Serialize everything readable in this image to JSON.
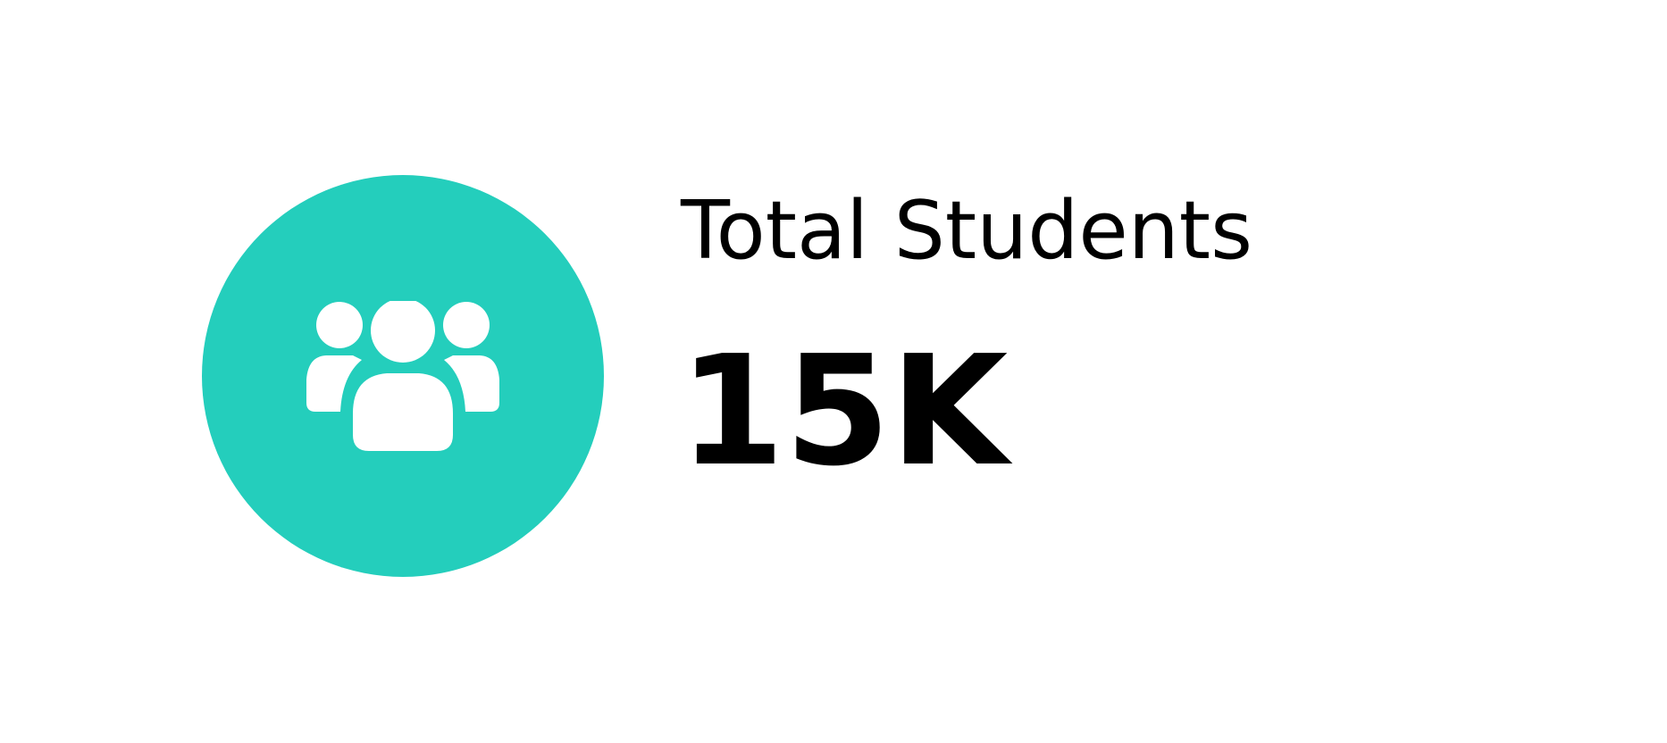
{
  "stat": {
    "icon": "group-users-icon",
    "label": "Total Students",
    "value": "15K"
  },
  "colors": {
    "accent": "#24CEBC",
    "icon": "#FFFFFF",
    "text": "#000000",
    "background": "#FFFFFF"
  }
}
